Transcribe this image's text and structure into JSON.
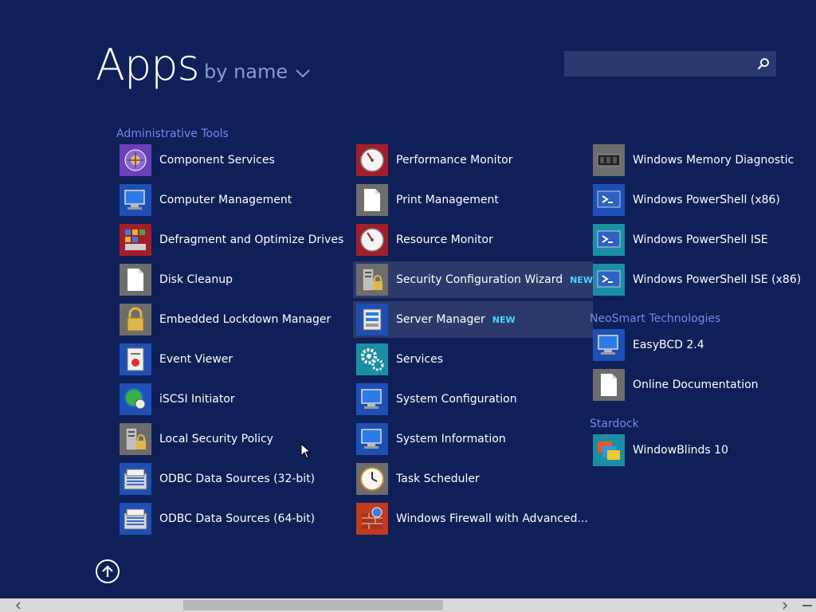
{
  "header": {
    "title": "Apps",
    "sort_label": "by name",
    "search_placeholder": ""
  },
  "columns": [
    {
      "groups": [
        {
          "name": "Administrative Tools",
          "items": [
            {
              "label": "Component Services",
              "icon": "component-services-icon",
              "color": "#6d3fb8"
            },
            {
              "label": "Computer Management",
              "icon": "computer-management-icon",
              "color": "#1e4fb5"
            },
            {
              "label": "Defragment and Optimize Drives",
              "icon": "defragment-icon",
              "color": "#a31e2a"
            },
            {
              "label": "Disk Cleanup",
              "icon": "document-icon",
              "color": "#6d6d6d"
            },
            {
              "label": "Embedded Lockdown Manager",
              "icon": "lock-icon",
              "color": "#6d6d6d"
            },
            {
              "label": "Event Viewer",
              "icon": "event-viewer-icon",
              "color": "#1e4fb5"
            },
            {
              "label": "iSCSI Initiator",
              "icon": "iscsi-icon",
              "color": "#1e4fb5"
            },
            {
              "label": "Local Security Policy",
              "icon": "security-policy-icon",
              "color": "#6d6d6d"
            },
            {
              "label": "ODBC Data Sources (32-bit)",
              "icon": "odbc-icon",
              "color": "#1e4fb5"
            },
            {
              "label": "ODBC Data Sources (64-bit)",
              "icon": "odbc-icon",
              "color": "#1e4fb5"
            }
          ]
        }
      ]
    },
    {
      "groups": [
        {
          "name": "",
          "items": [
            {
              "label": "Performance Monitor",
              "icon": "gauge-icon",
              "color": "#a31e2a"
            },
            {
              "label": "Print Management",
              "icon": "document-icon",
              "color": "#6d6d6d"
            },
            {
              "label": "Resource Monitor",
              "icon": "gauge-icon",
              "color": "#a31e2a"
            },
            {
              "label": "Security Configuration Wizard",
              "icon": "security-wizard-icon",
              "color": "#6d6d6d",
              "badge": "NEW",
              "highlight": true
            },
            {
              "label": "Server Manager",
              "icon": "server-manager-icon",
              "color": "#1e4fb5",
              "badge": "NEW",
              "highlight": true
            },
            {
              "label": "Services",
              "icon": "gears-icon",
              "color": "#1a8fa3"
            },
            {
              "label": "System Configuration",
              "icon": "system-config-icon",
              "color": "#1e4fb5"
            },
            {
              "label": "System Information",
              "icon": "system-info-icon",
              "color": "#1e4fb5"
            },
            {
              "label": "Task Scheduler",
              "icon": "clock-icon",
              "color": "#6d6d6d"
            },
            {
              "label": "Windows Firewall with Advanced...",
              "icon": "firewall-icon",
              "color": "#c23a1f"
            }
          ]
        }
      ]
    },
    {
      "groups": [
        {
          "name": "",
          "items": [
            {
              "label": "Windows Memory Diagnostic",
              "icon": "memory-icon",
              "color": "#6d6d6d"
            },
            {
              "label": "Windows PowerShell (x86)",
              "icon": "powershell-icon",
              "color": "#1e4fb5"
            },
            {
              "label": "Windows PowerShell ISE",
              "icon": "powershell-ise-icon",
              "color": "#1a8fa3"
            },
            {
              "label": "Windows PowerShell ISE (x86)",
              "icon": "powershell-ise-icon",
              "color": "#1a8fa3"
            }
          ]
        },
        {
          "name": "NeoSmart Technologies",
          "items": [
            {
              "label": "EasyBCD 2.4",
              "icon": "easybcd-icon",
              "color": "#1e4fb5"
            },
            {
              "label": "Online Documentation",
              "icon": "document-icon",
              "color": "#6d6d6d"
            }
          ]
        },
        {
          "name": "Stardock",
          "items": [
            {
              "label": "WindowBlinds 10",
              "icon": "windowblinds-icon",
              "color": "#1a8fa3"
            }
          ]
        }
      ]
    }
  ]
}
